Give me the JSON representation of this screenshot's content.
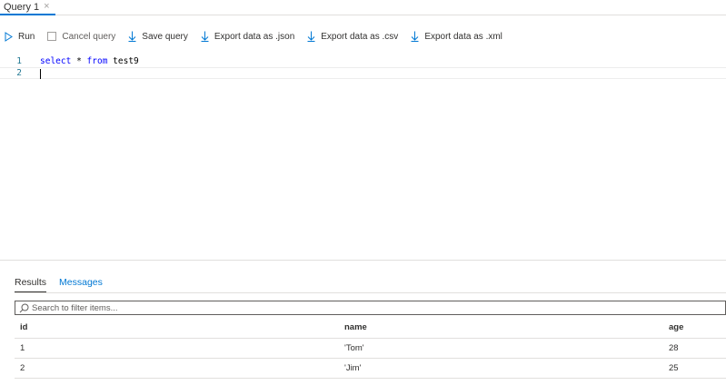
{
  "tab": {
    "label": "Query 1",
    "close_glyph": "×"
  },
  "toolbar": {
    "run_label": "Run",
    "cancel_label": "Cancel query",
    "save_label": "Save query",
    "export_json_label": "Export data as .json",
    "export_csv_label": "Export data as .csv",
    "export_xml_label": "Export data as .xml",
    "accent_color": "#0078d4"
  },
  "editor": {
    "lines": [
      {
        "number": "1",
        "keyword1": "select",
        "operator": "*",
        "keyword2": "from",
        "identifier": "test9"
      },
      {
        "number": "2",
        "text": ""
      }
    ]
  },
  "results": {
    "tabs": {
      "results_label": "Results",
      "messages_label": "Messages"
    },
    "filter_placeholder": "Search to filter items...",
    "columns": [
      "id",
      "name",
      "age"
    ],
    "rows": [
      [
        "1",
        "'Tom'",
        "28"
      ],
      [
        "2",
        "'Jim'",
        "25"
      ]
    ]
  }
}
